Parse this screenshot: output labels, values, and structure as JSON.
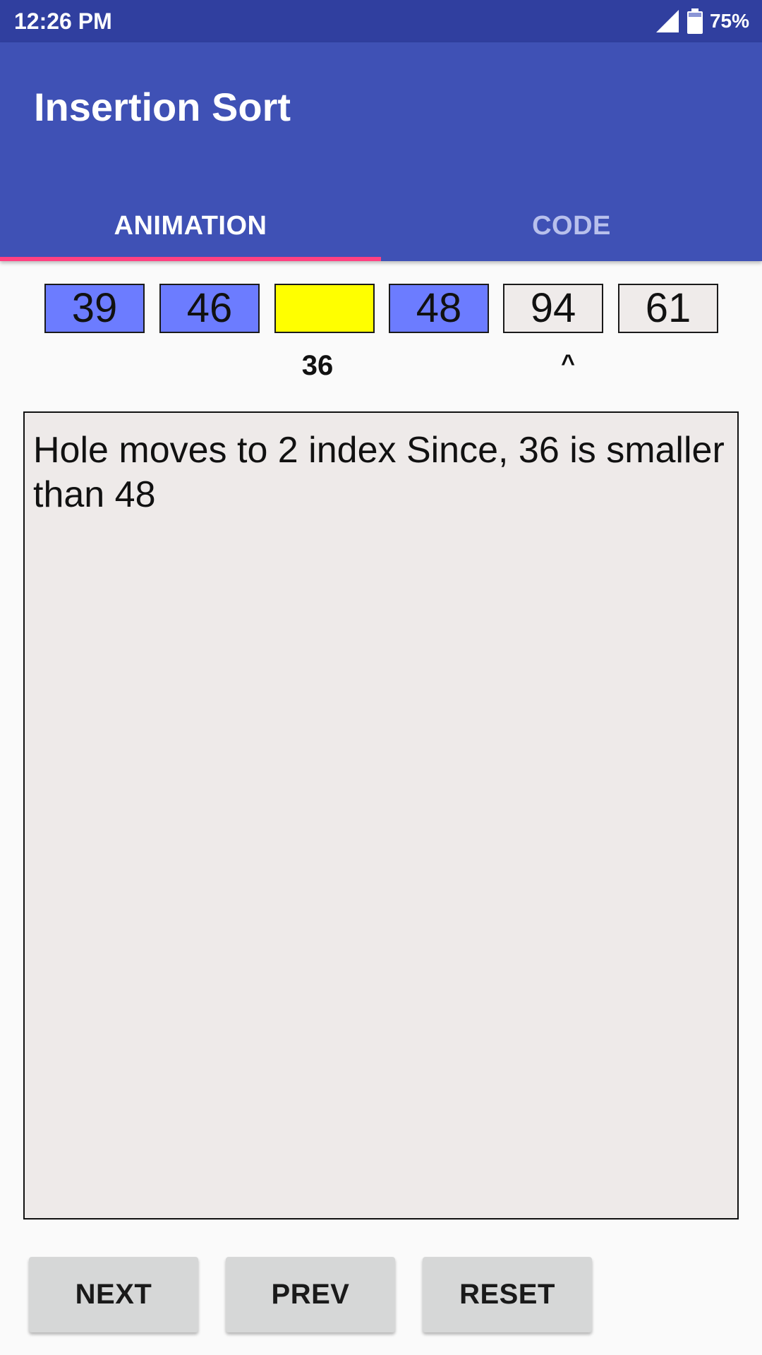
{
  "status_bar": {
    "time": "12:26 PM",
    "battery_percent": "75%",
    "icons": [
      "signal-icon",
      "battery-icon"
    ]
  },
  "app_bar": {
    "title": "Insertion Sort",
    "tabs": [
      {
        "label": "ANIMATION",
        "selected": true
      },
      {
        "label": "CODE",
        "selected": false
      }
    ],
    "color": "#3f51b5",
    "status_color": "#303f9f",
    "indicator_color": "#ff4081"
  },
  "array": {
    "cells": [
      {
        "value": "39",
        "state": "sorted"
      },
      {
        "value": "46",
        "state": "sorted"
      },
      {
        "value": "",
        "state": "hole"
      },
      {
        "value": "48",
        "state": "sorted"
      },
      {
        "value": "94",
        "state": "unsorted"
      },
      {
        "value": "61",
        "state": "unsorted"
      }
    ],
    "hole_value": "36",
    "pointer": "^",
    "colors": {
      "sorted": "#6c7cff",
      "hole": "#ffff00",
      "unsorted": "#efebea"
    }
  },
  "message": {
    "text": "Hole moves to 2 index Since, 36 is smaller than 48"
  },
  "buttons": {
    "next": "NEXT",
    "prev": "PREV",
    "reset": "RESET"
  }
}
